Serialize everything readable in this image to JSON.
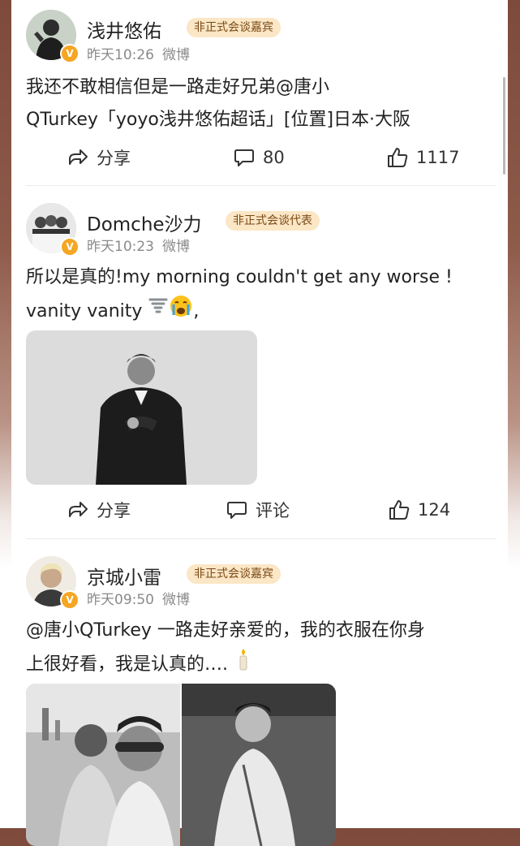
{
  "posts": [
    {
      "username": "浅井悠佑",
      "tag": "非正式会谈嘉宾",
      "time": "昨天10:26",
      "source": "微博",
      "text_line1": "我还不敢相信但是一路走好兄弟@唐小",
      "text_line2": "QTurkey「yoyo浅井悠佑超话」[位置]日本·大阪",
      "share_label": "分享",
      "comment_label": "80",
      "like_count": "1117"
    },
    {
      "username": "Domche沙力",
      "tag": "非正式会谈代表",
      "time": "昨天10:23",
      "source": "微博",
      "text_line1": "所以是真的!my morning couldn't get any worse !",
      "text_line2": "vanity vanity",
      "text_line2_tail": ",",
      "share_label": "分享",
      "comment_label": "评论",
      "like_count": "124"
    },
    {
      "username": "京城小雷",
      "tag": "非正式会谈嘉宾",
      "time": "昨天09:50",
      "source": "微博",
      "text_line1": "@唐小QTurkey 一路走好亲爱的，我的衣服在你身",
      "text_line2": "上很好看，我是认真的…."
    }
  ],
  "badge_glyph": "V",
  "icons": {
    "share": "share-arrow-icon",
    "comment": "comment-bubble-icon",
    "like": "thumbs-up-icon",
    "verified": "verified-v-icon",
    "tornado": "tornado-emoji",
    "crying": "loudly-crying-emoji",
    "candle": "candle-emoji"
  },
  "colors": {
    "tag_bg": "#fbe6c5",
    "tag_text": "#7a4a16",
    "verified": "#f5a623",
    "meta_text": "#8a8a8a"
  }
}
